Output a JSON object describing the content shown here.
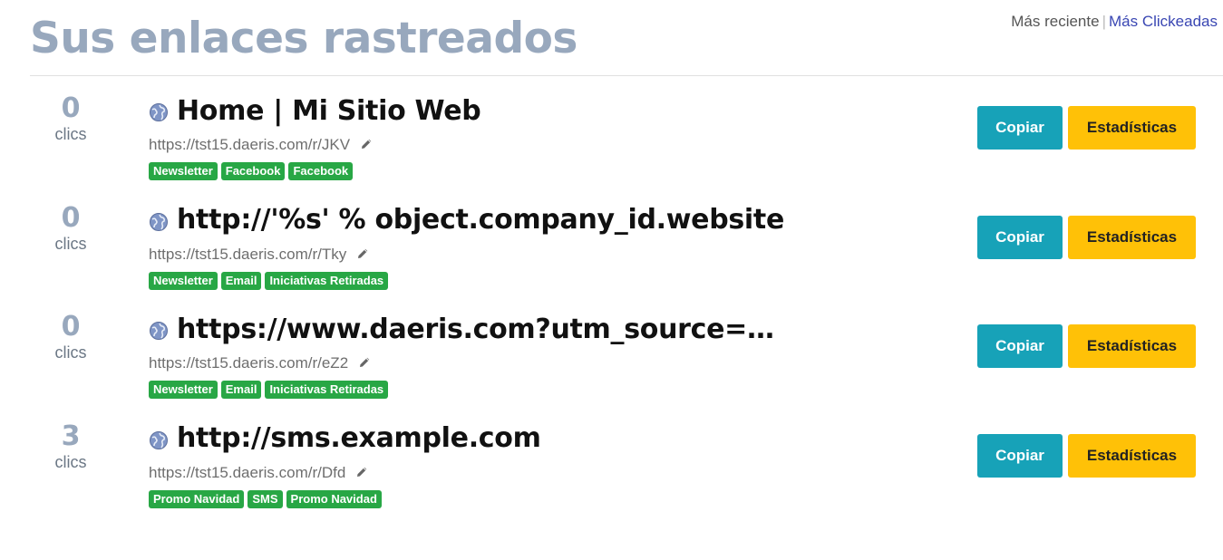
{
  "header": {
    "title": "Sus enlaces rastreados",
    "sort_recent": "Más reciente",
    "sort_separator": "|",
    "sort_most_clicked": "Más Clickeadas"
  },
  "links": [
    {
      "count": "0",
      "count_label": "clics",
      "title": "Home | Mi Sitio Web",
      "short_url": "https://tst15.daeris.com/r/JKV",
      "tags": [
        "Newsletter",
        "Facebook",
        "Facebook"
      ],
      "copy_label": "Copiar",
      "stats_label": "Estadísticas"
    },
    {
      "count": "0",
      "count_label": "clics",
      "title": "http://'%s' % object.company_id.website",
      "short_url": "https://tst15.daeris.com/r/Tky",
      "tags": [
        "Newsletter",
        "Email",
        "Iniciativas Retiradas"
      ],
      "copy_label": "Copiar",
      "stats_label": "Estadísticas"
    },
    {
      "count": "0",
      "count_label": "clics",
      "title": "https://www.daeris.com?utm_source=db...",
      "short_url": "https://tst15.daeris.com/r/eZ2",
      "tags": [
        "Newsletter",
        "Email",
        "Iniciativas Retiradas"
      ],
      "copy_label": "Copiar",
      "stats_label": "Estadísticas"
    },
    {
      "count": "3",
      "count_label": "clics",
      "title": "http://sms.example.com",
      "short_url": "https://tst15.daeris.com/r/Dfd",
      "tags": [
        "Promo Navidad",
        "SMS",
        "Promo Navidad"
      ],
      "copy_label": "Copiar",
      "stats_label": "Estadísticas"
    }
  ],
  "icons": {
    "favicon": "globe-icon",
    "edit": "pencil-icon"
  },
  "colors": {
    "title": "#98a8bd",
    "tag": "#28a745",
    "copy_button": "#17a2b8",
    "stats_button": "#ffc107",
    "active_sort_link": "#3a47b3"
  }
}
